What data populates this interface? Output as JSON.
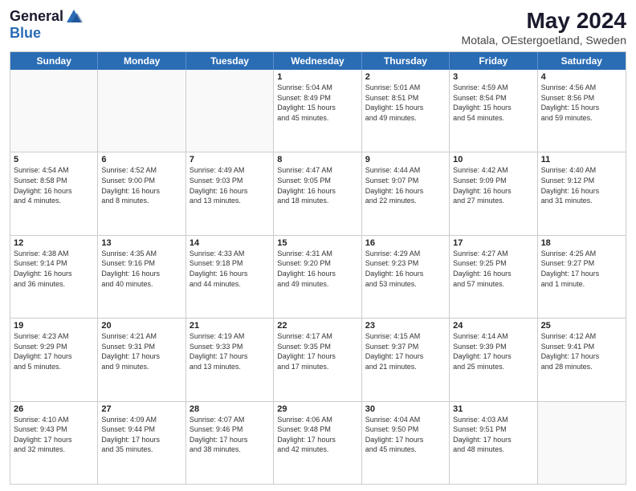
{
  "header": {
    "logo_general": "General",
    "logo_blue": "Blue",
    "title": "May 2024",
    "subtitle": "Motala, OEstergoetland, Sweden"
  },
  "days_of_week": [
    "Sunday",
    "Monday",
    "Tuesday",
    "Wednesday",
    "Thursday",
    "Friday",
    "Saturday"
  ],
  "weeks": [
    [
      {
        "day": "",
        "info": "",
        "empty": true
      },
      {
        "day": "",
        "info": "",
        "empty": true
      },
      {
        "day": "",
        "info": "",
        "empty": true
      },
      {
        "day": "1",
        "info": "Sunrise: 5:04 AM\nSunset: 8:49 PM\nDaylight: 15 hours\nand 45 minutes.",
        "empty": false
      },
      {
        "day": "2",
        "info": "Sunrise: 5:01 AM\nSunset: 8:51 PM\nDaylight: 15 hours\nand 49 minutes.",
        "empty": false
      },
      {
        "day": "3",
        "info": "Sunrise: 4:59 AM\nSunset: 8:54 PM\nDaylight: 15 hours\nand 54 minutes.",
        "empty": false
      },
      {
        "day": "4",
        "info": "Sunrise: 4:56 AM\nSunset: 8:56 PM\nDaylight: 15 hours\nand 59 minutes.",
        "empty": false
      }
    ],
    [
      {
        "day": "5",
        "info": "Sunrise: 4:54 AM\nSunset: 8:58 PM\nDaylight: 16 hours\nand 4 minutes.",
        "empty": false
      },
      {
        "day": "6",
        "info": "Sunrise: 4:52 AM\nSunset: 9:00 PM\nDaylight: 16 hours\nand 8 minutes.",
        "empty": false
      },
      {
        "day": "7",
        "info": "Sunrise: 4:49 AM\nSunset: 9:03 PM\nDaylight: 16 hours\nand 13 minutes.",
        "empty": false
      },
      {
        "day": "8",
        "info": "Sunrise: 4:47 AM\nSunset: 9:05 PM\nDaylight: 16 hours\nand 18 minutes.",
        "empty": false
      },
      {
        "day": "9",
        "info": "Sunrise: 4:44 AM\nSunset: 9:07 PM\nDaylight: 16 hours\nand 22 minutes.",
        "empty": false
      },
      {
        "day": "10",
        "info": "Sunrise: 4:42 AM\nSunset: 9:09 PM\nDaylight: 16 hours\nand 27 minutes.",
        "empty": false
      },
      {
        "day": "11",
        "info": "Sunrise: 4:40 AM\nSunset: 9:12 PM\nDaylight: 16 hours\nand 31 minutes.",
        "empty": false
      }
    ],
    [
      {
        "day": "12",
        "info": "Sunrise: 4:38 AM\nSunset: 9:14 PM\nDaylight: 16 hours\nand 36 minutes.",
        "empty": false
      },
      {
        "day": "13",
        "info": "Sunrise: 4:35 AM\nSunset: 9:16 PM\nDaylight: 16 hours\nand 40 minutes.",
        "empty": false
      },
      {
        "day": "14",
        "info": "Sunrise: 4:33 AM\nSunset: 9:18 PM\nDaylight: 16 hours\nand 44 minutes.",
        "empty": false
      },
      {
        "day": "15",
        "info": "Sunrise: 4:31 AM\nSunset: 9:20 PM\nDaylight: 16 hours\nand 49 minutes.",
        "empty": false
      },
      {
        "day": "16",
        "info": "Sunrise: 4:29 AM\nSunset: 9:23 PM\nDaylight: 16 hours\nand 53 minutes.",
        "empty": false
      },
      {
        "day": "17",
        "info": "Sunrise: 4:27 AM\nSunset: 9:25 PM\nDaylight: 16 hours\nand 57 minutes.",
        "empty": false
      },
      {
        "day": "18",
        "info": "Sunrise: 4:25 AM\nSunset: 9:27 PM\nDaylight: 17 hours\nand 1 minute.",
        "empty": false
      }
    ],
    [
      {
        "day": "19",
        "info": "Sunrise: 4:23 AM\nSunset: 9:29 PM\nDaylight: 17 hours\nand 5 minutes.",
        "empty": false
      },
      {
        "day": "20",
        "info": "Sunrise: 4:21 AM\nSunset: 9:31 PM\nDaylight: 17 hours\nand 9 minutes.",
        "empty": false
      },
      {
        "day": "21",
        "info": "Sunrise: 4:19 AM\nSunset: 9:33 PM\nDaylight: 17 hours\nand 13 minutes.",
        "empty": false
      },
      {
        "day": "22",
        "info": "Sunrise: 4:17 AM\nSunset: 9:35 PM\nDaylight: 17 hours\nand 17 minutes.",
        "empty": false
      },
      {
        "day": "23",
        "info": "Sunrise: 4:15 AM\nSunset: 9:37 PM\nDaylight: 17 hours\nand 21 minutes.",
        "empty": false
      },
      {
        "day": "24",
        "info": "Sunrise: 4:14 AM\nSunset: 9:39 PM\nDaylight: 17 hours\nand 25 minutes.",
        "empty": false
      },
      {
        "day": "25",
        "info": "Sunrise: 4:12 AM\nSunset: 9:41 PM\nDaylight: 17 hours\nand 28 minutes.",
        "empty": false
      }
    ],
    [
      {
        "day": "26",
        "info": "Sunrise: 4:10 AM\nSunset: 9:43 PM\nDaylight: 17 hours\nand 32 minutes.",
        "empty": false
      },
      {
        "day": "27",
        "info": "Sunrise: 4:09 AM\nSunset: 9:44 PM\nDaylight: 17 hours\nand 35 minutes.",
        "empty": false
      },
      {
        "day": "28",
        "info": "Sunrise: 4:07 AM\nSunset: 9:46 PM\nDaylight: 17 hours\nand 38 minutes.",
        "empty": false
      },
      {
        "day": "29",
        "info": "Sunrise: 4:06 AM\nSunset: 9:48 PM\nDaylight: 17 hours\nand 42 minutes.",
        "empty": false
      },
      {
        "day": "30",
        "info": "Sunrise: 4:04 AM\nSunset: 9:50 PM\nDaylight: 17 hours\nand 45 minutes.",
        "empty": false
      },
      {
        "day": "31",
        "info": "Sunrise: 4:03 AM\nSunset: 9:51 PM\nDaylight: 17 hours\nand 48 minutes.",
        "empty": false
      },
      {
        "day": "",
        "info": "",
        "empty": true
      }
    ]
  ]
}
